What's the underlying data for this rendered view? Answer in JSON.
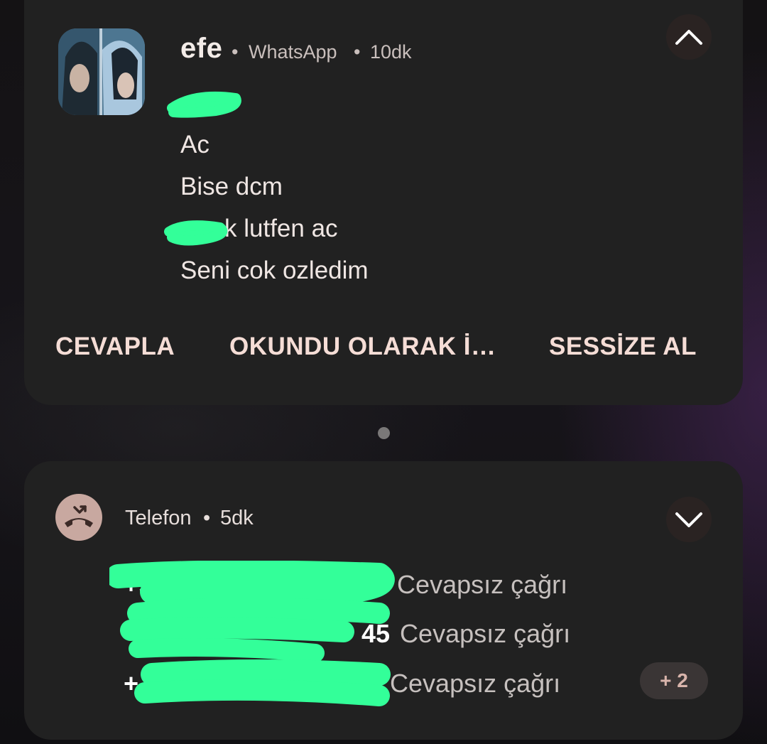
{
  "whatsapp_notification": {
    "sender": "efe",
    "app": "WhatsApp",
    "time": "10dk",
    "messages": [
      "",
      "Ac",
      "Bise dcm",
      "k lutfen ac",
      "Seni cok ozledim"
    ],
    "actions": [
      "CEVAPLA",
      "OKUNDU OLARAK İ…",
      "SESSİZE AL"
    ],
    "collapse_icon": "chevron-up-icon",
    "avatar_icon": "contact-avatar"
  },
  "page_indicator": {
    "dots": 1
  },
  "phone_notification": {
    "app": "Telefon",
    "time": "5dk",
    "app_icon": "missed-call-icon",
    "expand_icon": "chevron-down-icon",
    "calls": [
      {
        "number": "+9",
        "status": "Cevapsız çağrı"
      },
      {
        "number": "45",
        "status": "Cevapsız çağrı"
      },
      {
        "number": "+",
        "status": "Cevapsız çağrı"
      }
    ],
    "more_count": "+ 2"
  },
  "colors": {
    "card_bg": "#212121",
    "action_text": "#f5ddd6",
    "redaction": "#33ff99",
    "phone_icon_bg": "#c8a8a0"
  }
}
